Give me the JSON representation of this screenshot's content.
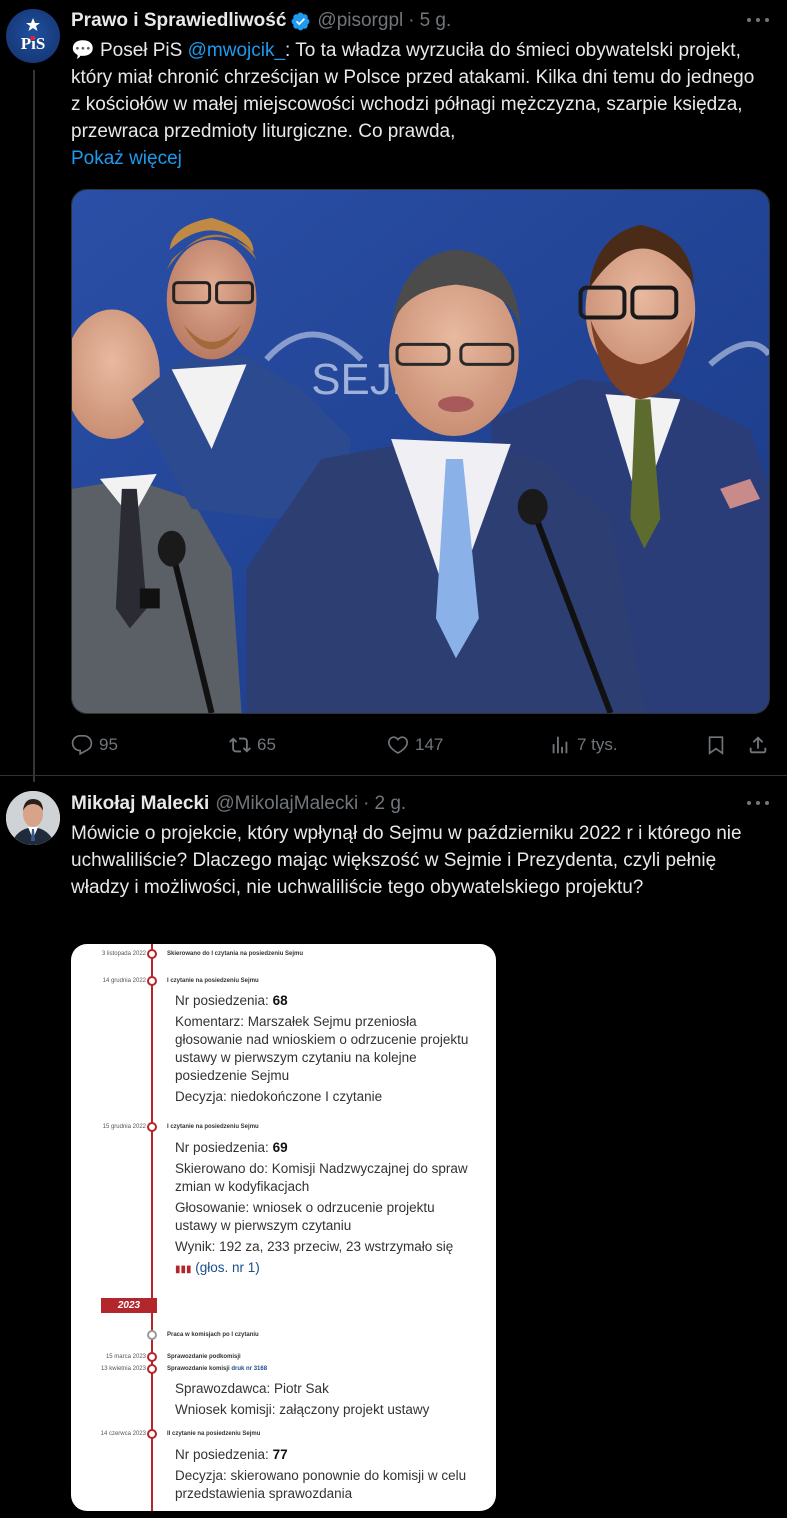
{
  "tweet1": {
    "author_name": "Prawo i Sprawiedliwość",
    "handle": "@pisorgpl",
    "time": "5 g.",
    "avatar_text": "PiS",
    "text_icon": "💬",
    "text_prefix": " Poseł PiS ",
    "mention": "@mwojcik_",
    "text_body": ": To ta władza wyrzuciła do śmieci obywatelski projekt, który miał chronić chrześcijan w Polsce przed atakami. Kilka dni temu do jednego z kościołów w małej miejscowości wchodzi półnagi mężczyzna, szarpie księdza, przewraca przedmioty liturgiczne. Co prawda,",
    "show_more": "Pokaż więcej",
    "photo_backdrop_text": "SEJM",
    "stats": {
      "replies": "95",
      "retweets": "65",
      "likes": "147",
      "views": "7 tys."
    }
  },
  "tweet2": {
    "author_name": "Mikołaj Malecki",
    "handle": "@MikolajMalecki",
    "time": "2 g.",
    "text": "Mówicie o projekcie, który wpłynął do Sejmu w październiku 2022 r i którego nie uchwaliliście? Dlaczego mając większość w Sejmie i Prezydenta, czyli pełnię władzy i możliwości, nie uchwaliliście tego obywatelskiego projektu?",
    "timeline": {
      "e1": {
        "date": "3 listopada 2022",
        "title": "Skierowano do I czytania na posiedzeniu Sejmu"
      },
      "e2": {
        "date": "14 grudnia 2022",
        "title": "I czytanie na posiedzeniu Sejmu",
        "nr_label": "Nr posiedzenia: ",
        "nr_value": "68",
        "comment": "Komentarz: Marszałek Sejmu przeniosła głosowanie nad wnioskiem o odrzucenie projektu ustawy w pierwszym czytaniu na kolejne posiedzenie Sejmu",
        "decision": "Decyzja: niedokończone I czytanie"
      },
      "e3": {
        "date": "15 grudnia 2022",
        "title": "I czytanie na posiedzeniu Sejmu",
        "nr_label": "Nr posiedzenia: ",
        "nr_value": "69",
        "directed": "Skierowano do: Komisji Nadzwyczajnej do spraw zmian w kodyfikacjach",
        "vote": "Głosowanie: wniosek o odrzucenie projektu ustawy w pierwszym czytaniu",
        "result": "Wynik: 192 za, 233 przeciw, 23 wstrzymało się",
        "vote_link": "(głos. nr 1)"
      },
      "year": "2023",
      "e4": {
        "title": "Praca w komisjach po I czytaniu"
      },
      "e5": {
        "date": "15 marca 2023",
        "title": "Sprawozdanie podkomisji"
      },
      "e6": {
        "date": "13 kwietnia 2023",
        "title": "Sprawozdanie komisji",
        "druk": "druk nr 3168",
        "reporter": "Sprawozdawca: Piotr Sak",
        "motion": "Wniosek komisji: załączony projekt ustawy"
      },
      "e7": {
        "date": "14 czerwca 2023",
        "title": "II czytanie na posiedzeniu Sejmu",
        "nr_label": "Nr posiedzenia: ",
        "nr_value": "77",
        "decision": "Decyzja: skierowano ponownie do komisji w celu przedstawienia sprawozdania"
      }
    }
  },
  "colors": {
    "background": "#000000",
    "text": "#e7e9ea",
    "muted": "#71767b",
    "link": "#1d9bf0",
    "verified": "#1d9bf0",
    "timeline_red": "#b3262b"
  }
}
